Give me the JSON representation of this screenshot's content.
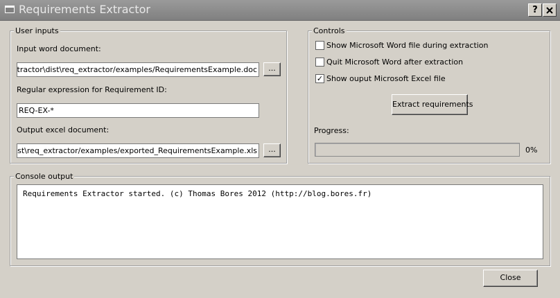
{
  "window": {
    "title": "Requirements Extractor",
    "help_button": "?",
    "close_button": "X"
  },
  "user_inputs": {
    "title": "User inputs",
    "input_word_label": "Input word document:",
    "input_word_value": "\\req_extractor\\dist\\req_extractor/examples/RequirementsExample.doc",
    "browse_label": "...",
    "regex_label": "Regular expression for Requirement ID:",
    "regex_value": "REQ-EX-*",
    "output_excel_label": "Output excel document:",
    "output_excel_value": "actor\\dist\\req_extractor/examples/exported_RequirementsExample.xls"
  },
  "controls": {
    "title": "Controls",
    "options": [
      {
        "label": "Show Microsoft Word file during extraction",
        "checked": false
      },
      {
        "label": "Quit Microsoft Word after extraction",
        "checked": false
      },
      {
        "label": "Show ouput Microsoft Excel file",
        "checked": true
      }
    ],
    "check_mark": "✓",
    "extract_button": "Extract requirements",
    "progress_label": "Progress:",
    "progress_value": 0,
    "progress_text": "0%"
  },
  "console": {
    "title": "Console output",
    "text": "Requirements Extractor started. (c) Thomas Bores 2012 (http://blog.bores.fr)"
  },
  "footer": {
    "close_button": "Close"
  },
  "colors": {
    "window_bg": "#d4d0c8",
    "titlebar": "#808080",
    "progress_fill": "#3a6ea5"
  }
}
